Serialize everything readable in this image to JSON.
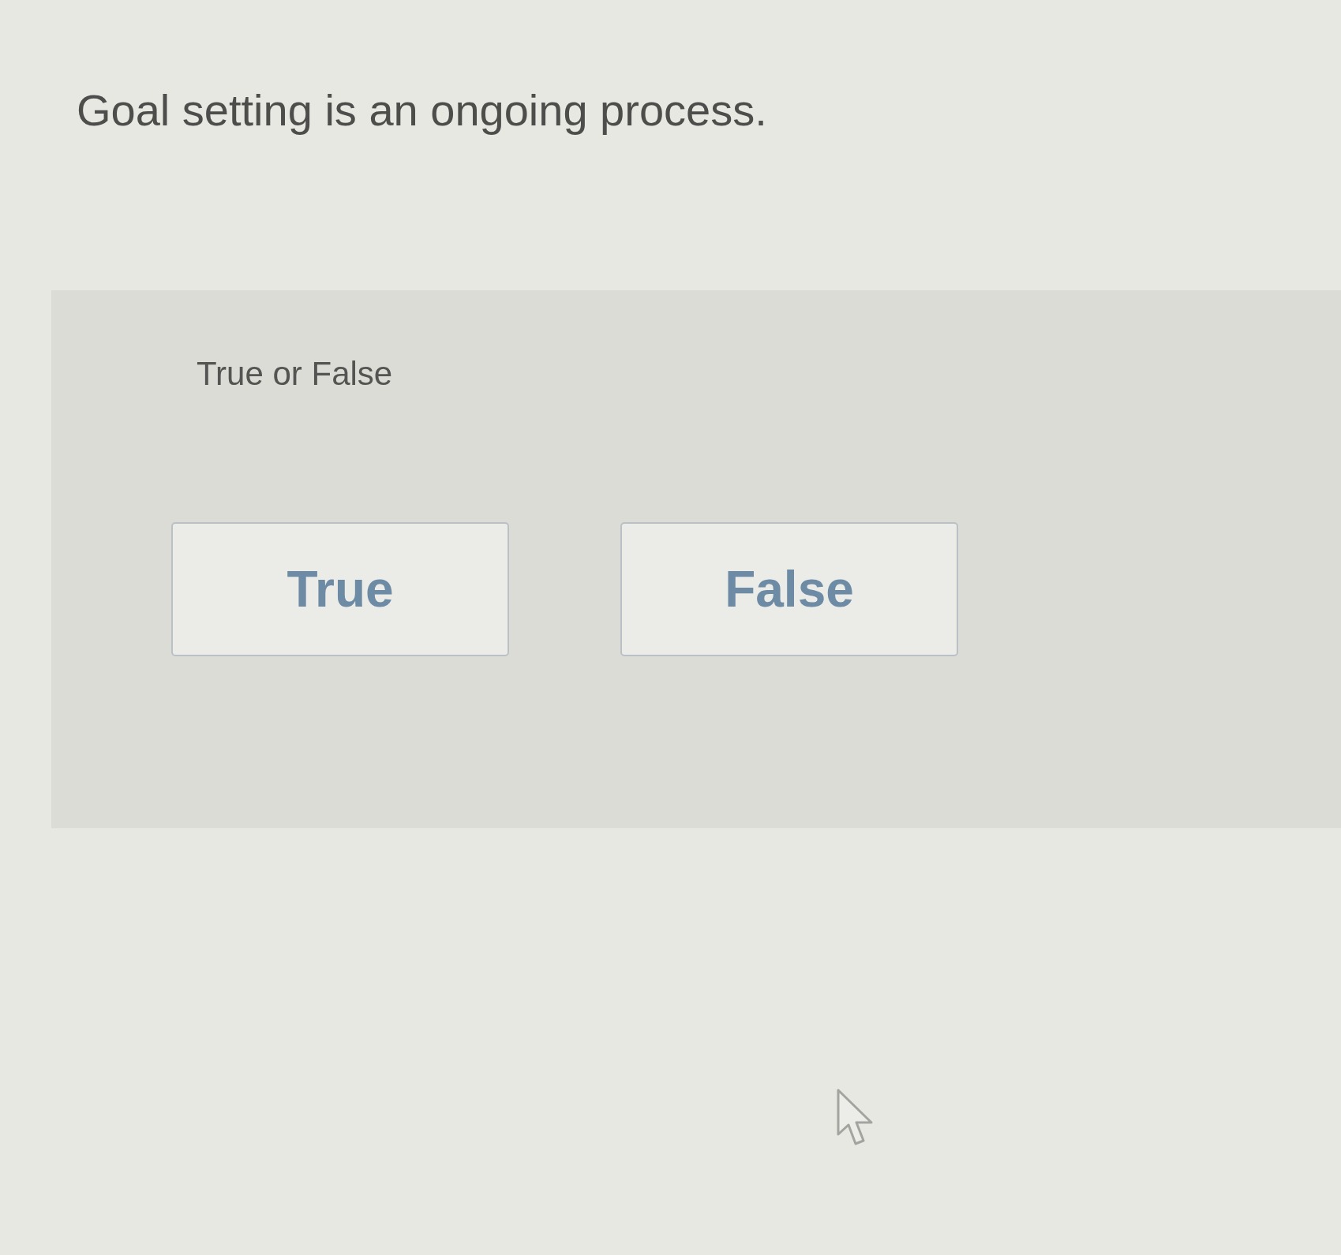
{
  "question": "Goal setting is an ongoing process.",
  "answer_panel": {
    "prompt": "True or False",
    "options": [
      {
        "label": "True",
        "selected": false
      },
      {
        "label": "False",
        "selected": false
      }
    ]
  }
}
